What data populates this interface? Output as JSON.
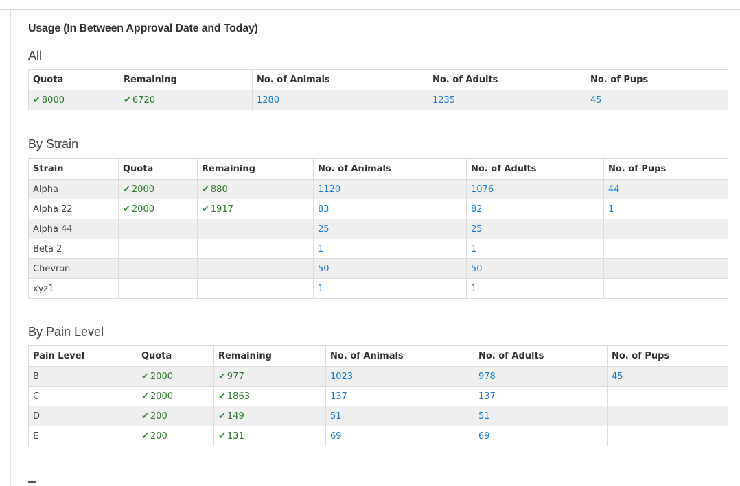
{
  "usage_title": "Usage (In Between Approval Date and Today)",
  "check_icon": "✔",
  "all": {
    "title": "All",
    "headers": [
      "Quota",
      "Remaining",
      "No. of Animals",
      "No. of Adults",
      "No. of Pups"
    ],
    "rows": [
      {
        "quota": "8000",
        "remaining": "6720",
        "animals": "1280",
        "adults": "1235",
        "pups": "45"
      }
    ]
  },
  "by_strain": {
    "title": "By Strain",
    "headers": [
      "Strain",
      "Quota",
      "Remaining",
      "No. of Animals",
      "No. of Adults",
      "No. of Pups"
    ],
    "rows": [
      {
        "name": "Alpha",
        "quota": "2000",
        "remaining": "880",
        "animals": "1120",
        "adults": "1076",
        "pups": "44"
      },
      {
        "name": "Alpha 22",
        "quota": "2000",
        "remaining": "1917",
        "animals": "83",
        "adults": "82",
        "pups": "1"
      },
      {
        "name": "Alpha 44",
        "quota": "",
        "remaining": "",
        "animals": "25",
        "adults": "25",
        "pups": ""
      },
      {
        "name": "Beta 2",
        "quota": "",
        "remaining": "",
        "animals": "1",
        "adults": "1",
        "pups": ""
      },
      {
        "name": "Chevron",
        "quota": "",
        "remaining": "",
        "animals": "50",
        "adults": "50",
        "pups": ""
      },
      {
        "name": "xyz1",
        "quota": "",
        "remaining": "",
        "animals": "1",
        "adults": "1",
        "pups": ""
      }
    ]
  },
  "by_pain_level": {
    "title": "By Pain Level",
    "headers": [
      "Pain Level",
      "Quota",
      "Remaining",
      "No. of Animals",
      "No. of Adults",
      "No. of Pups"
    ],
    "rows": [
      {
        "name": "B",
        "quota": "2000",
        "remaining": "977",
        "animals": "1023",
        "adults": "978",
        "pups": "45"
      },
      {
        "name": "C",
        "quota": "2000",
        "remaining": "1863",
        "animals": "137",
        "adults": "137",
        "pups": ""
      },
      {
        "name": "D",
        "quota": "200",
        "remaining": "149",
        "animals": "51",
        "adults": "51",
        "pups": ""
      },
      {
        "name": "E",
        "quota": "200",
        "remaining": "131",
        "animals": "69",
        "adults": "69",
        "pups": ""
      }
    ]
  },
  "colors": {
    "link": "#1a7bd4",
    "ok": "#2f7a2f",
    "stripe": "#efefef",
    "border": "#dcdcdc"
  }
}
